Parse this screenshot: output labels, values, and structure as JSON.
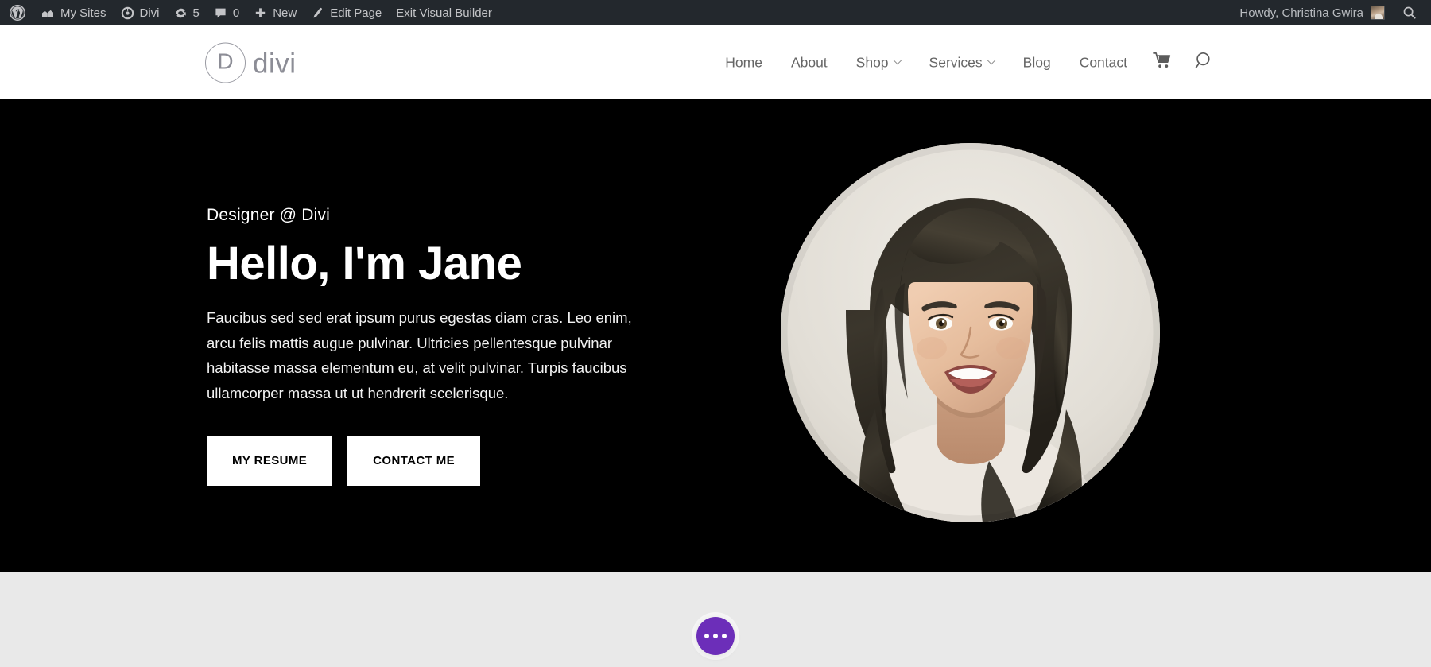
{
  "admin_bar": {
    "wp_logo_icon": "wordpress-icon",
    "items": [
      {
        "icon": "sites-icon",
        "label": "My Sites"
      },
      {
        "icon": "divi-icon",
        "label": "Divi"
      },
      {
        "icon": "updates-icon",
        "label": "5"
      },
      {
        "icon": "comments-icon",
        "label": "0"
      },
      {
        "icon": "plus-icon",
        "label": "New"
      },
      {
        "icon": "pencil-icon",
        "label": "Edit Page"
      },
      {
        "icon": "",
        "label": "Exit Visual Builder"
      }
    ],
    "howdy": "Howdy, Christina Gwira",
    "avatar_icon": "user-avatar",
    "search_icon": "search-icon",
    "background_color": "#23282d",
    "text_color": "#c3c4c7"
  },
  "header": {
    "logo": {
      "mark": "D",
      "word": "divi",
      "color": "#8c8d96"
    },
    "nav": [
      {
        "label": "Home",
        "has_dropdown": false
      },
      {
        "label": "About",
        "has_dropdown": false
      },
      {
        "label": "Shop",
        "has_dropdown": true
      },
      {
        "label": "Services",
        "has_dropdown": true
      },
      {
        "label": "Blog",
        "has_dropdown": false
      },
      {
        "label": "Contact",
        "has_dropdown": false
      }
    ],
    "cart_icon": "shopping-cart-icon",
    "search_icon": "search-icon",
    "background_color": "#ffffff"
  },
  "hero": {
    "eyebrow": "Designer @ Divi",
    "title": "Hello, I'm Jane",
    "body": "Faucibus sed sed erat ipsum purus egestas diam cras. Leo enim, arcu felis mattis augue pulvinar. Ultricies pellentesque pulvinar habitasse massa elementum eu, at velit pulvinar. Turpis faucibus ullamcorper massa ut ut hendrerit scelerisque.",
    "buttons": [
      {
        "label": "MY RESUME"
      },
      {
        "label": "CONTACT ME"
      }
    ],
    "portrait_alt": "portrait-photo-of-smiling-woman",
    "background_color": "#000000",
    "text_color": "#ffffff"
  },
  "lower_section": {
    "background_color": "#e9e9e9"
  },
  "visual_builder_button": {
    "icon": "ellipsis-icon",
    "color": "#6c2eb9"
  }
}
